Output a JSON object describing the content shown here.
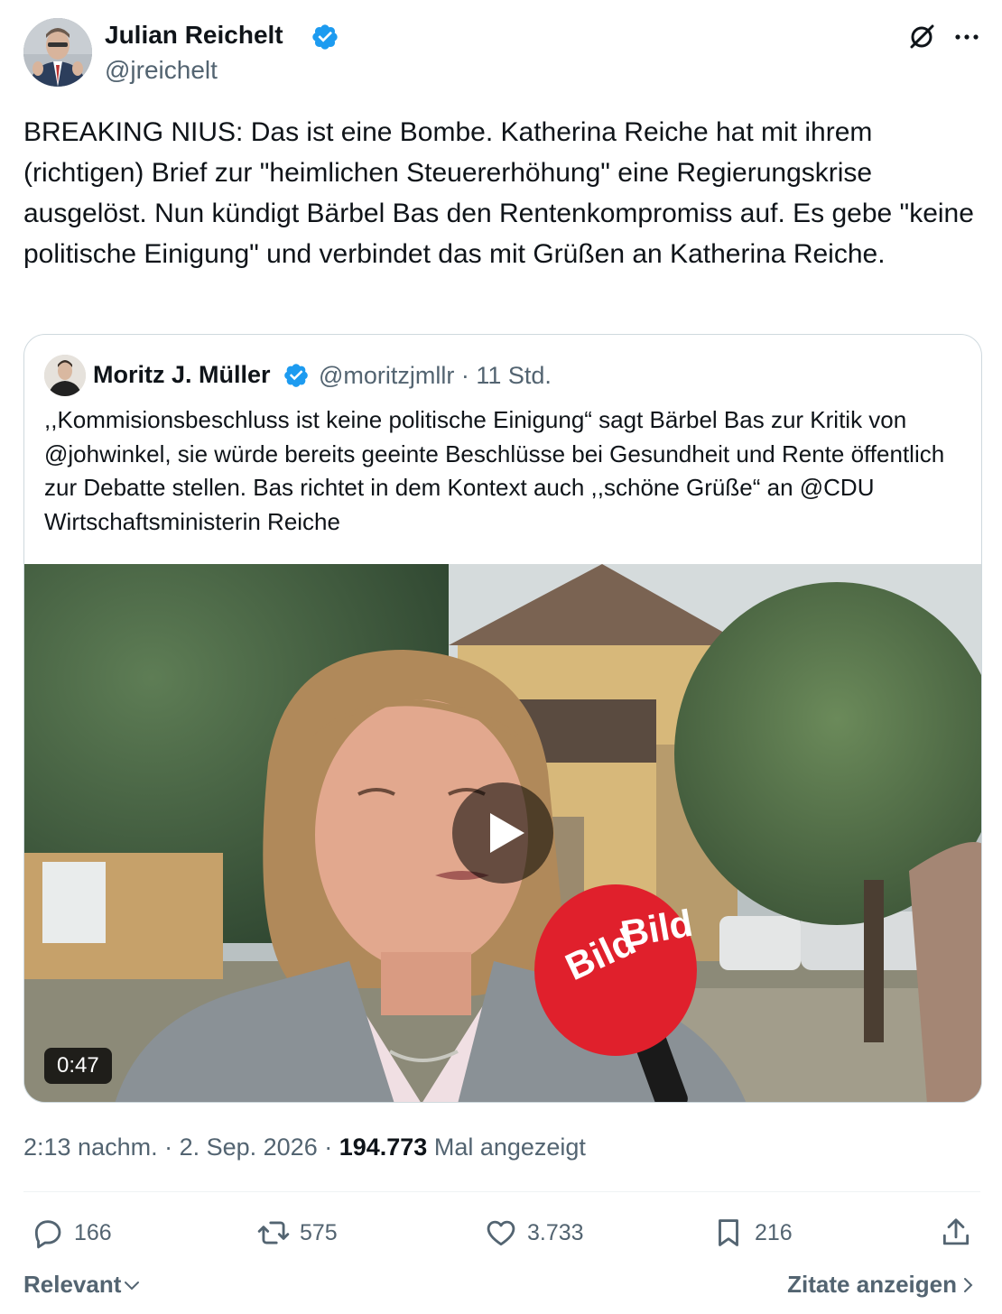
{
  "author": {
    "name": "Julian Reichelt",
    "handle": "@jreichelt"
  },
  "tweet_text": "BREAKING NIUS: Das ist eine Bombe. Katherina Reiche hat mit ihrem (richtigen) Brief zur \"heimlichen Steuererhöhung\" eine Regierungskrise ausgelöst. Nun kündigt Bärbel Bas den Rentenkompromiss auf. Es gebe \"keine politische Einigung\" und verbindet das mit Grüßen an Katherina Reiche.",
  "quoted": {
    "name": "Moritz J. Müller",
    "meta": "@moritzjmllr · 11 Std.",
    "text": ",,Kommisionsbeschluss ist keine politische Einigung“ sagt Bärbel Bas zur Kritik von @johwinkel, sie würde bereits geeinte Beschlüsse bei Gesundheit und Rente öffentlich zur Debatte stellen. Bas richtet in dem Kontext auch ,,schöne Grüße“ an @CDU Wirtschaftsministerin Reiche",
    "video_duration": "0:47",
    "mic_logo_text": "Bild"
  },
  "timestamp": {
    "time_date": "2:13 nachm. · 2. Sep. 2026 · ",
    "views_count": "194.773",
    "views_label": " Mal angezeigt"
  },
  "actions": {
    "replies": "166",
    "reposts": "575",
    "likes": "3.733",
    "bookmarks": "216"
  },
  "footer": {
    "sort_label": "Relevant",
    "quotes_link": "Zitate anzeigen"
  },
  "colors": {
    "verified": "#1d9bf0",
    "secondary_text": "#536471",
    "primary_text": "#0f1419",
    "border": "#cfd9de"
  }
}
